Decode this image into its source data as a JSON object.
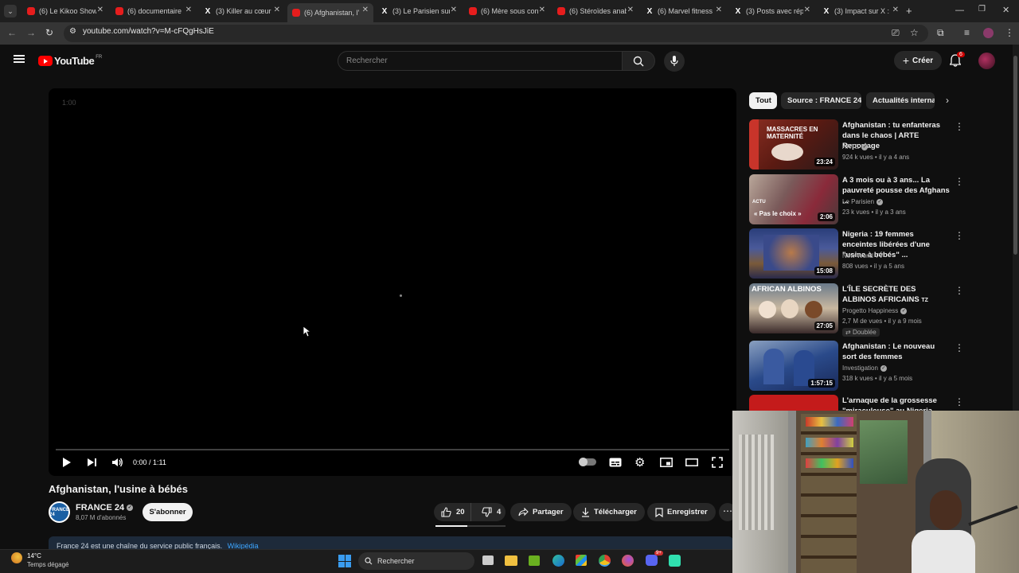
{
  "tabs": [
    {
      "label": "(6) Le Kikoo Show",
      "icon": "youtube-icon"
    },
    {
      "label": "(6) documentaire",
      "icon": "youtube-icon"
    },
    {
      "label": "(3) Killer au cœur",
      "icon": "x-icon"
    },
    {
      "label": "(6) Afghanistan, l'",
      "icon": "youtube-icon",
      "active": true
    },
    {
      "label": "(3) Le Parisien sur",
      "icon": "x-icon"
    },
    {
      "label": "(6) Mère sous con",
      "icon": "youtube-icon"
    },
    {
      "label": "(6) Stéroïdes anab",
      "icon": "youtube-icon"
    },
    {
      "label": "(6) Marvel fitness",
      "icon": "youtube-icon"
    },
    {
      "label": "(3) Posts avec rép",
      "icon": "x-icon"
    },
    {
      "label": "(3) Impact sur X :",
      "icon": "x-icon"
    }
  ],
  "address": {
    "url": "youtube.com/watch?v=M-cFQgHsJiE"
  },
  "header": {
    "logo_text": "YouTube",
    "region": "FR",
    "search_placeholder": "Rechercher",
    "create_label": "Créer",
    "notification_count": "6"
  },
  "player": {
    "overlay_time": "1:00",
    "time_display": "0:00 / 1:11",
    "progress": 0.0
  },
  "video": {
    "title": "Afghanistan, l'usine à bébés",
    "channel_name": "FRANCE 24",
    "channel_avatar_text": "FRANCE 24",
    "subscribers": "8,07 M d'abonnés",
    "subscribe_label": "S'abonner",
    "likes": "20",
    "dislikes": "4",
    "share_label": "Partager",
    "download_label": "Télécharger",
    "save_label": "Enregistrer",
    "description_preview": "France 24 est une chaîne du service public français.",
    "description_link": "Wikipédia"
  },
  "chips": [
    "Tout",
    "Source : FRANCE 24",
    "Actualités internat"
  ],
  "recommendations": [
    {
      "title": "Afghanistan : tu enfanteras dans le chaos | ARTE Reportage",
      "channel": "ARTE",
      "verified": true,
      "meta": "924 k vues • il y a 4 ans",
      "duration": "23:24",
      "thumb_text": "MASSACRES EN MATERNITÉ",
      "thumb_color": "#7a2a1f"
    },
    {
      "title": "A 3 mois ou à 3 ans... La pauvreté pousse des Afghans ...",
      "channel": "Le Parisien",
      "verified": true,
      "meta": "23 k vues • il y a 3 ans",
      "duration": "2:06",
      "thumb_text": "« Pas le choix »",
      "thumb_color": "#6e5a58"
    },
    {
      "title": "Nigeria : 19 femmes enceintes libérées d'une \"usine à bébés\" ...",
      "channel": "New World TV",
      "verified": false,
      "meta": "808 vues • il y a 5 ans",
      "duration": "15:08",
      "thumb_text": "",
      "thumb_color": "#2c3a66"
    },
    {
      "title": "L'ÎLE SECRÈTE DES ALBINOS AFRICAINS",
      "channel": "Progetto Happiness",
      "verified": true,
      "meta": "2,7 M de vues • il y a 9 mois",
      "badge": "Doublée",
      "duration": "27:05",
      "thumb_text": "AFRICAN ALBINOS",
      "thumb_color": "#7d6a55"
    },
    {
      "title": "Afghanistan : Le nouveau sort des femmes",
      "channel": "Investigation",
      "verified": true,
      "meta": "318 k vues • il y a 5 mois",
      "duration": "1:57:15",
      "thumb_text": "",
      "thumb_color": "#3a4b6a"
    },
    {
      "title": "L'arnaque de la grossesse \"miraculeuse\" au Nigeria",
      "channel": "",
      "verified": false,
      "meta": "",
      "duration": "",
      "thumb_text": "",
      "thumb_color": "#c41b1b"
    }
  ],
  "taskbar": {
    "weather_temp": "14°C",
    "weather_desc": "Temps dégagé",
    "search_label": "Rechercher",
    "discord_badge": "9+"
  },
  "colors": {
    "brand_red": "#ff0000",
    "bg": "#0f0f0f",
    "link_blue": "#3ea6ff"
  }
}
